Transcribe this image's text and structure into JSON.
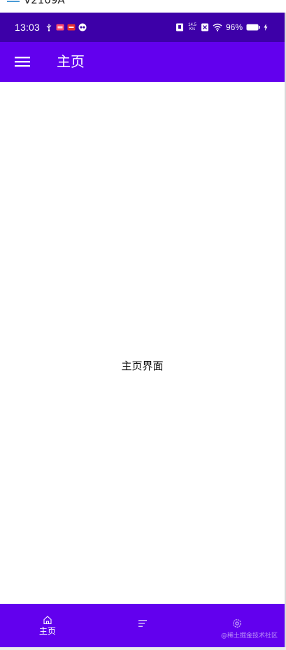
{
  "window": {
    "title": "V2109A",
    "maximize_icon": "maximize-icon",
    "close_icon": "close-icon"
  },
  "status_bar": {
    "time": "13:03",
    "battery": "96%",
    "net_speed_value": "14.5",
    "net_speed_unit": "K/s",
    "icons": [
      "usb-icon",
      "app-notification-icon",
      "app-notification-icon-2",
      "app-notification-icon-3",
      "screenshot-icon",
      "sim-icon",
      "wifi-icon",
      "battery-icon",
      "charging-icon"
    ],
    "background": "#3d00a8"
  },
  "app_bar": {
    "title": "主页",
    "menu_icon": "hamburger-menu-icon",
    "background": "#6200ee"
  },
  "content": {
    "text": "主页界面"
  },
  "bottom_nav": {
    "background": "#6200ee",
    "items": [
      {
        "label": "主页",
        "icon": "home-icon",
        "selected": true
      },
      {
        "label": "",
        "icon": "list-icon",
        "selected": false
      },
      {
        "label": "",
        "icon": "settings-icon",
        "selected": false
      }
    ]
  },
  "watermark": "@稀土掘金技术社区"
}
